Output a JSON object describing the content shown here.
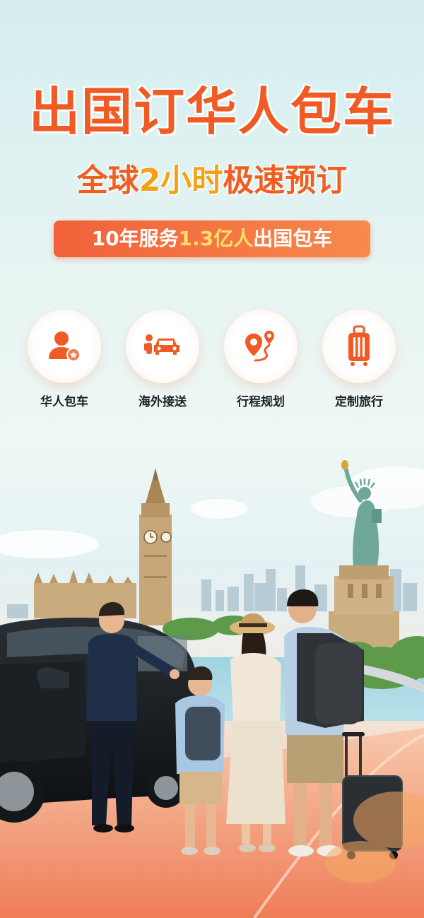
{
  "hero": {
    "title": "出国订华人包车",
    "subtitle_prefix": "全球",
    "subtitle_highlight": "2小时",
    "subtitle_suffix": "极速预订",
    "tag_prefix": "10年服务",
    "tag_highlight": "1.3亿人",
    "tag_suffix": "出国包车"
  },
  "services": [
    {
      "label": "华人包车",
      "icon": "chinese-driver-icon"
    },
    {
      "label": "海外接送",
      "icon": "airport-transfer-icon"
    },
    {
      "label": "行程规划",
      "icon": "route-planning-icon"
    },
    {
      "label": "定制旅行",
      "icon": "luggage-icon"
    }
  ],
  "colors": {
    "brand_orange": "#f05a24",
    "highlight_yellow": "#f4a116",
    "tag_highlight": "#ffe06a"
  }
}
